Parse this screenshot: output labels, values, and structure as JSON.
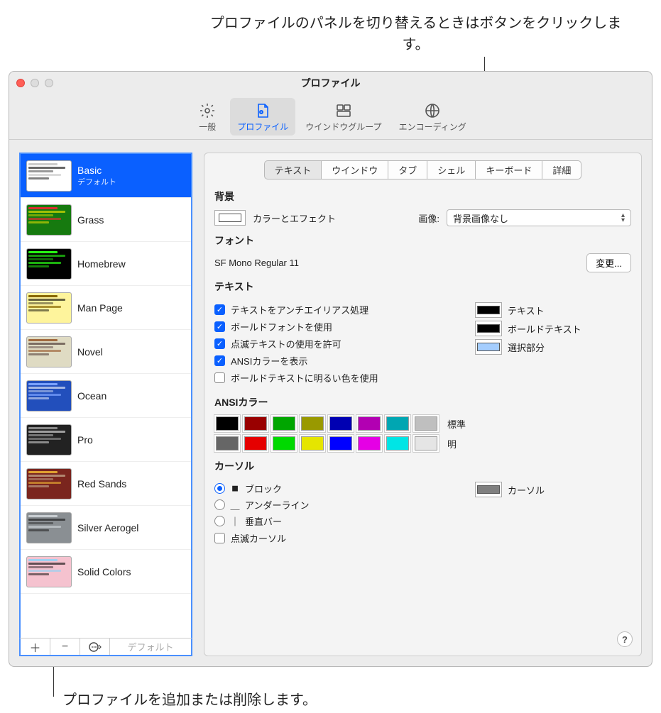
{
  "callouts": {
    "top": "プロファイルのパネルを切り替えるときはボタンをクリックします。",
    "bottom": "プロファイルを追加または削除します。"
  },
  "window": {
    "title": "プロファイル"
  },
  "toolbar": {
    "items": [
      {
        "label": "一般",
        "icon": "gear"
      },
      {
        "label": "プロファイル",
        "icon": "profile",
        "active": true
      },
      {
        "label": "ウインドウグループ",
        "icon": "wingroup"
      },
      {
        "label": "エンコーディング",
        "icon": "encoding"
      }
    ]
  },
  "sidebar": {
    "profiles": [
      {
        "name": "Basic",
        "sub": "デフォルト",
        "bg": "#ffffff",
        "fg": "#000000",
        "accent": "#cccccc",
        "selected": true
      },
      {
        "name": "Grass",
        "bg": "#167a0f",
        "fg": "#fff000",
        "accent": "#d93030"
      },
      {
        "name": "Homebrew",
        "bg": "#000000",
        "fg": "#28fe14",
        "accent": "#28fe14"
      },
      {
        "name": "Man Page",
        "bg": "#fef49c",
        "fg": "#000000",
        "accent": "#886600"
      },
      {
        "name": "Novel",
        "bg": "#dfdbc3",
        "fg": "#3b2322",
        "accent": "#a06a3f"
      },
      {
        "name": "Ocean",
        "bg": "#224fbc",
        "fg": "#ffffff",
        "accent": "#7aa2ff"
      },
      {
        "name": "Pro",
        "bg": "#222222",
        "fg": "#f2f2f2",
        "accent": "#888888"
      },
      {
        "name": "Red Sands",
        "bg": "#7a251e",
        "fg": "#d7c9a7",
        "accent": "#e0a030"
      },
      {
        "name": "Silver Aerogel",
        "bg": "#8a8f93",
        "fg": "#111111",
        "accent": "#c8cdd1"
      },
      {
        "name": "Solid Colors",
        "bg": "#f5c2cf",
        "fg": "#000000",
        "accent": "#9ed0f0"
      }
    ],
    "footer": {
      "add": "＋",
      "remove": "−",
      "more": "⊙",
      "default": "デフォルト"
    }
  },
  "tabs": [
    "テキスト",
    "ウインドウ",
    "タブ",
    "シェル",
    "キーボード",
    "詳細"
  ],
  "active_tab": 0,
  "sections": {
    "background": {
      "title": "背景",
      "color_label": "カラーとエフェクト",
      "image_label": "画像:",
      "image_value": "背景画像なし",
      "well_color": "#ffffff"
    },
    "font": {
      "title": "フォント",
      "value": "SF Mono Regular 11",
      "change": "変更..."
    },
    "text": {
      "title": "テキスト",
      "checks": [
        {
          "label": "テキストをアンチエイリアス処理",
          "checked": true
        },
        {
          "label": "ボールドフォントを使用",
          "checked": true
        },
        {
          "label": "点滅テキストの使用を許可",
          "checked": true
        },
        {
          "label": "ANSIカラーを表示",
          "checked": true
        },
        {
          "label": "ボールドテキストに明るい色を使用",
          "checked": false
        }
      ],
      "color_labels": {
        "text": "テキスト",
        "bold": "ボールドテキスト",
        "selection": "選択部分"
      },
      "wells": {
        "text": "#000000",
        "bold": "#000000",
        "selection": "#a4cdfe"
      }
    },
    "ansi": {
      "title": "ANSIカラー",
      "normal_label": "標準",
      "bright_label": "明",
      "normal": [
        "#000000",
        "#990000",
        "#00a600",
        "#999900",
        "#0000b2",
        "#b200b2",
        "#00a6b2",
        "#bfbfbf"
      ],
      "bright": [
        "#666666",
        "#e50000",
        "#00d900",
        "#e5e500",
        "#0000ff",
        "#e500e5",
        "#00e5e5",
        "#e5e5e5"
      ]
    },
    "cursor": {
      "title": "カーソル",
      "options": [
        {
          "glyph": "■",
          "label": "ブロック",
          "checked": true
        },
        {
          "glyph": "＿",
          "label": "アンダーライン",
          "checked": false
        },
        {
          "glyph": "｜",
          "label": "垂直バー",
          "checked": false
        }
      ],
      "blink_label": "点滅カーソル",
      "blink_checked": false,
      "well_label": "カーソル",
      "well_color": "#7f7f7f"
    }
  },
  "help": "?"
}
